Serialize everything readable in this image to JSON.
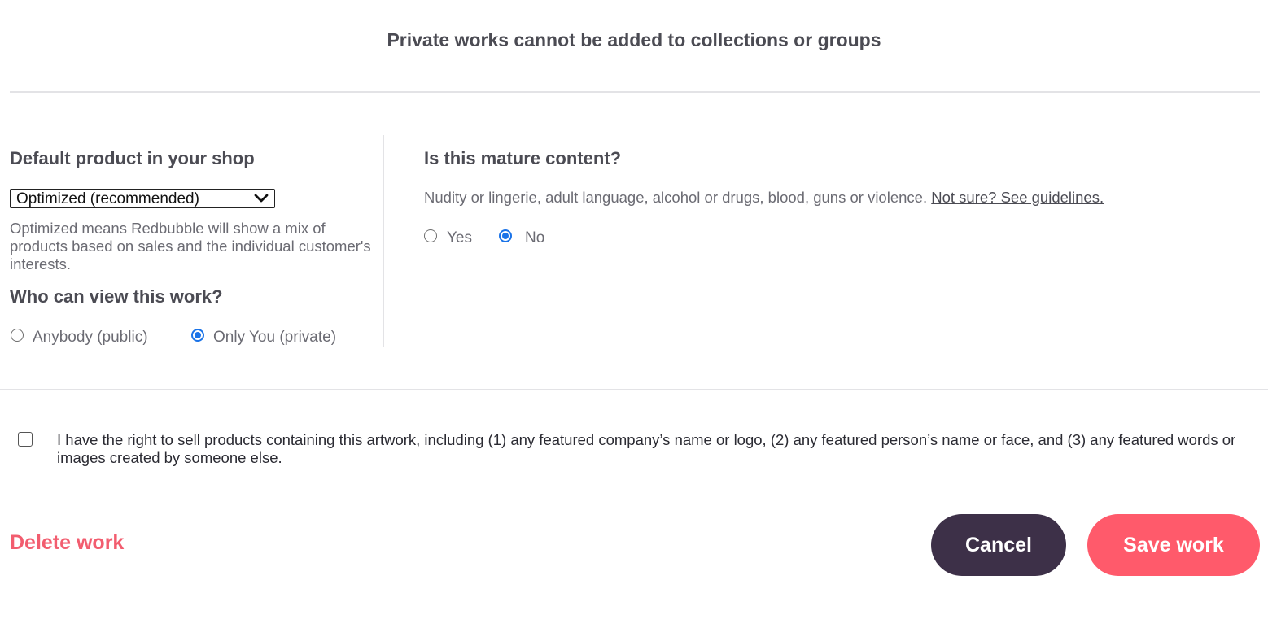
{
  "notice": "Private works cannot be added to collections or groups",
  "default_product": {
    "heading": "Default product in your shop",
    "selected": "Optimized (recommended)",
    "help": "Optimized means Redbubble will show a mix of products based on sales and the individual customer's interests."
  },
  "visibility": {
    "heading": "Who can view this work?",
    "options": [
      {
        "label": "Anybody (public)",
        "selected": false
      },
      {
        "label": "Only You (private)",
        "selected": true
      }
    ]
  },
  "mature": {
    "heading": "Is this mature content?",
    "description": "Nudity or lingerie, adult language, alcohol or drugs, blood, guns or violence.",
    "link": "Not sure? See guidelines.",
    "options": [
      {
        "label": "Yes",
        "selected": false
      },
      {
        "label": "No",
        "selected": true
      }
    ]
  },
  "rights": {
    "checked": false,
    "text": "I have the right to sell products containing this artwork, including (1) any featured company’s name or logo, (2) any featured person’s name or face, and (3) any featured words or images created by someone else."
  },
  "actions": {
    "delete": "Delete work",
    "cancel": "Cancel",
    "save": "Save work"
  },
  "colors": {
    "accent": "#ff5a6b",
    "cancel_bg": "#3d3048",
    "radio": "#1a73e8"
  }
}
